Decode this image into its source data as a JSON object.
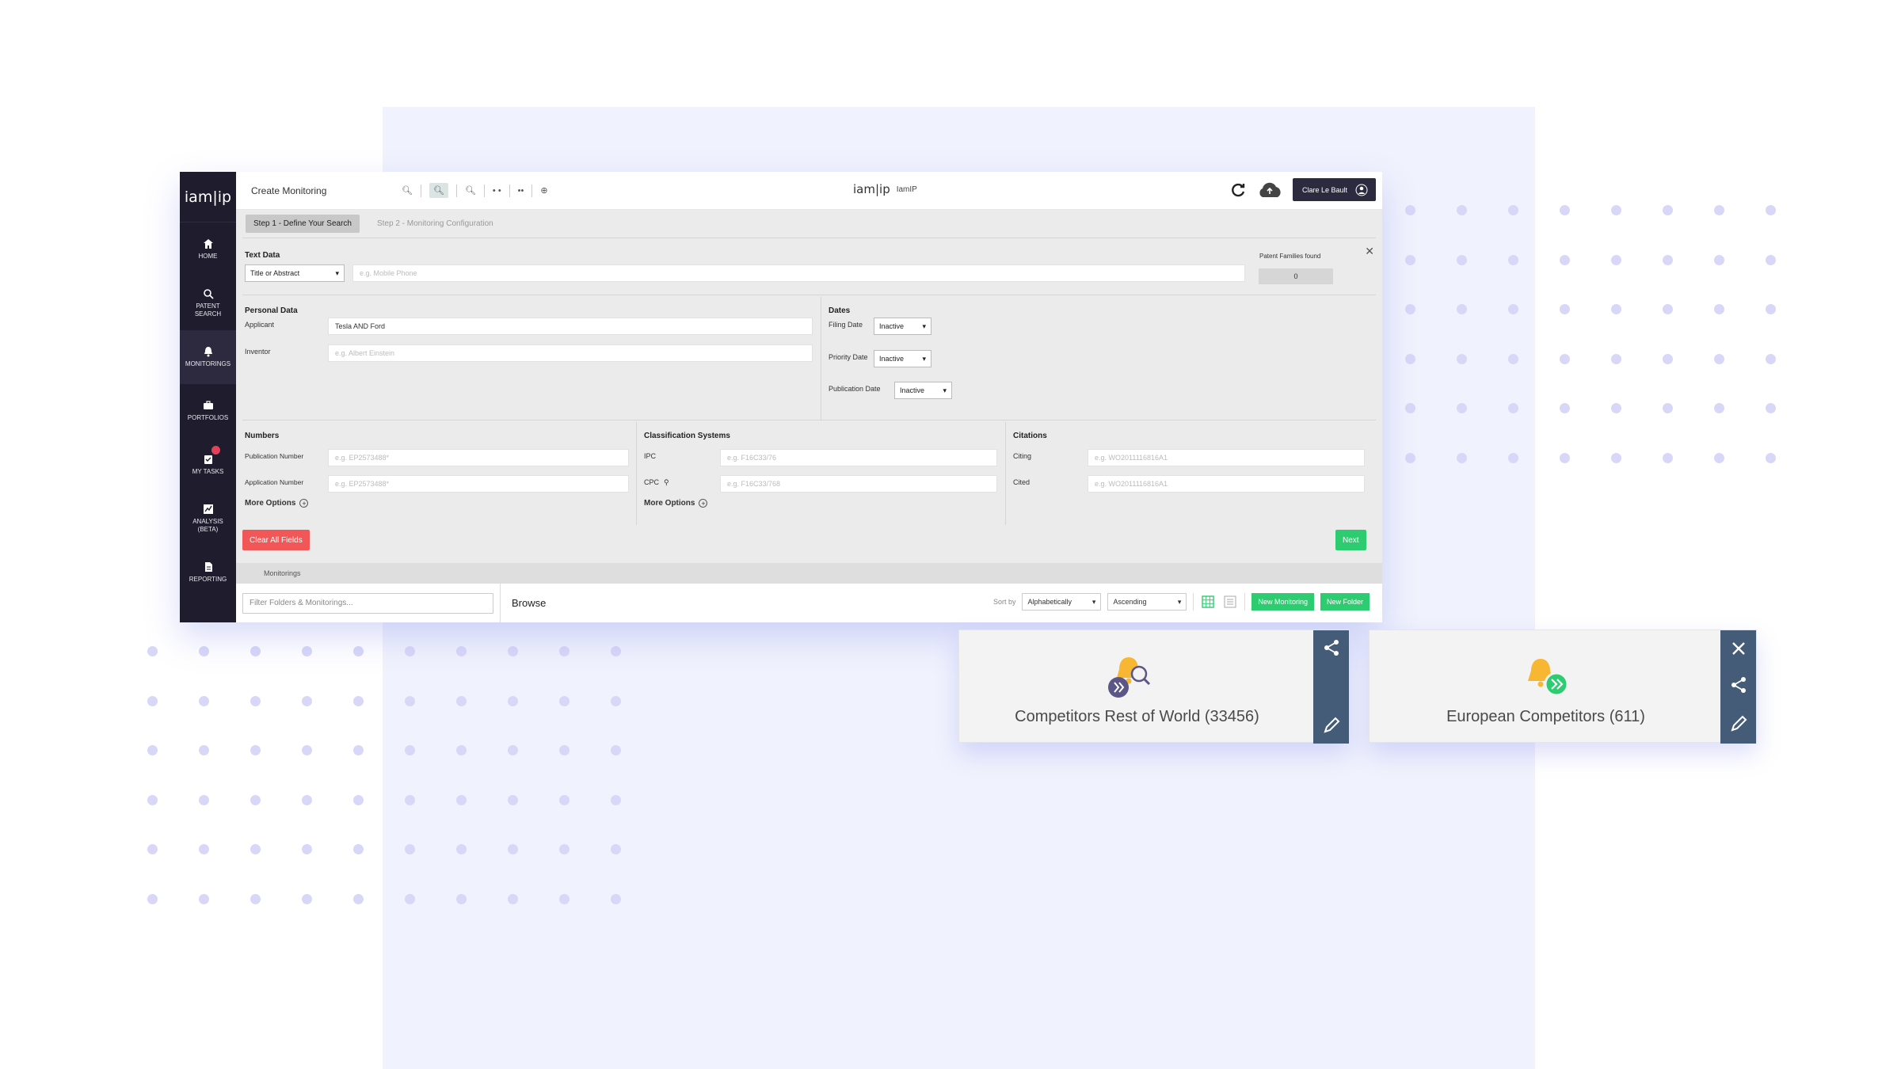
{
  "app": {
    "title": "Create Monitoring",
    "brand_logo": "iam|ip",
    "brand_name": "IamIP",
    "user_name": "Clare Le Bault"
  },
  "sidebar": {
    "logo": "iam|ip",
    "items": [
      {
        "label": "HOME",
        "icon": "home-icon"
      },
      {
        "label": "PATENT SEARCH",
        "icon": "search-icon"
      },
      {
        "label": "MONITORINGS",
        "icon": "bell-icon"
      },
      {
        "label": "PORTFOLIOS",
        "icon": "briefcase-icon"
      },
      {
        "label": "MY TASKS",
        "icon": "tasks-icon"
      },
      {
        "label": "ANALYSIS (BETA)",
        "icon": "chart-icon"
      },
      {
        "label": "REPORTING",
        "icon": "report-icon"
      }
    ]
  },
  "steps": {
    "step1": "Step 1 - Define Your Search",
    "step2": "Step 2 - Monitoring Configuration"
  },
  "text_data": {
    "title": "Text Data",
    "field_select": "Title or Abstract",
    "placeholder": "e.g. Mobile Phone",
    "found_label": "Patent Families found",
    "found_count": "0"
  },
  "personal_data": {
    "title": "Personal Data",
    "applicant_label": "Applicant",
    "applicant_value": "Tesla AND Ford",
    "inventor_label": "Inventor",
    "inventor_placeholder": "e.g. Albert Einstein"
  },
  "dates": {
    "title": "Dates",
    "filing_label": "Filing Date",
    "filing_value": "Inactive",
    "priority_label": "Priority Date",
    "priority_value": "Inactive",
    "publication_label": "Publication Date",
    "publication_value": "Inactive"
  },
  "numbers": {
    "title": "Numbers",
    "pub_label": "Publication Number",
    "pub_placeholder": "e.g. EP2573488*",
    "app_label": "Application Number",
    "app_placeholder": "e.g. EP2573488*",
    "more": "More Options"
  },
  "classification": {
    "title": "Classification Systems",
    "ipc_label": "IPC",
    "ipc_placeholder": "e.g. F16C33/76",
    "cpc_label": "CPC",
    "cpc_placeholder": "e.g. F16C33/768",
    "more": "More Options"
  },
  "citations": {
    "title": "Citations",
    "citing_label": "Citing",
    "citing_placeholder": "e.g. WO2011116816A1",
    "cited_label": "Cited",
    "cited_placeholder": "e.g. WO2011116816A1"
  },
  "actions": {
    "clear": "Clear All Fields",
    "next": "Next"
  },
  "browse": {
    "strip_label": "Monitorings",
    "filter_placeholder": "Filter Folders & Monitorings...",
    "browse_label": "Browse",
    "sort_by": "Sort by",
    "sort_value": "Alphabetically",
    "order_value": "Ascending",
    "new_monitoring": "New Monitoring",
    "new_folder": "New Folder"
  },
  "cards": [
    {
      "title": "Competitors Rest of World (33456)",
      "badge_color": "#5b5687"
    },
    {
      "title": "European Competitors (611)",
      "badge_color": "#2ecc71"
    }
  ],
  "colors": {
    "sidebar": "#1f1d2d",
    "accent_green": "#2ecc71",
    "accent_red": "#f15757",
    "card_side": "#455c78",
    "bell": "#f7b733"
  }
}
